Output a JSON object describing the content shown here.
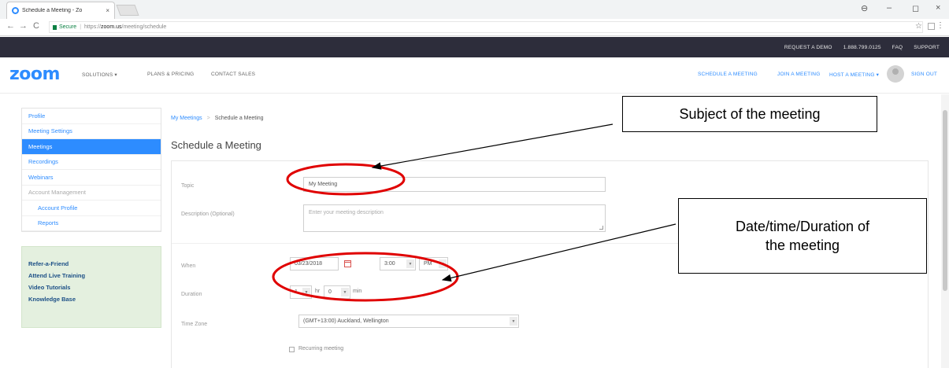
{
  "browser": {
    "tab_title": "Schedule a Meeting - Zo",
    "tab_close": "×",
    "controls": {
      "minimize": "–",
      "restore": "◻",
      "close": "×",
      "account": "⊖"
    },
    "secure_label": "Secure",
    "url_protocol": "https://",
    "url_host": "zoom.us",
    "url_path": "/meeting/schedule"
  },
  "topbar": {
    "links": [
      "REQUEST A DEMO",
      "1.888.799.0125",
      "FAQ",
      "SUPPORT"
    ]
  },
  "nav": {
    "logo": "zoom",
    "left_links": [
      "SOLUTIONS ▾",
      "PLANS & PRICING",
      "CONTACT SALES"
    ],
    "right_links": [
      "SCHEDULE A MEETING",
      "JOIN A MEETING",
      "HOST A MEETING ▾"
    ],
    "sign_out": "SIGN OUT"
  },
  "sidebar": {
    "items": [
      {
        "label": "Profile"
      },
      {
        "label": "Meeting Settings"
      },
      {
        "label": "Meetings"
      },
      {
        "label": "Recordings"
      },
      {
        "label": "Webinars"
      },
      {
        "label": "Account Management"
      },
      {
        "label": "Account Profile"
      },
      {
        "label": "Reports"
      }
    ],
    "help_links": [
      "Refer-a-Friend",
      "Attend Live Training",
      "Video Tutorials",
      "Knowledge Base"
    ]
  },
  "main": {
    "breadcrumb": {
      "link": "My Meetings",
      "separator": ">",
      "current": "Schedule a Meeting"
    },
    "title": "Schedule a Meeting",
    "form": {
      "topic_label": "Topic",
      "topic_value": "My Meeting",
      "description_label": "Description (Optional)",
      "description_placeholder": "Enter your meeting description",
      "when_label": "When",
      "date_value": "03/23/2018",
      "time_value": "3:00",
      "ampm_value": "PM",
      "duration_label": "Duration",
      "duration_hours": "1",
      "hr_label": "hr",
      "duration_minutes": "0",
      "min_label": "min",
      "timezone_label": "Time Zone",
      "timezone_value": "(GMT+13:00) Auckland, Wellington",
      "recurring_label": "Recurring meeting"
    }
  },
  "annotations": {
    "subject_callout": "Subject of the meeting",
    "datetime_callout_line1": "Date/time/Duration of",
    "datetime_callout_line2": "the meeting",
    "highlight_color": "#e00000"
  },
  "colors": {
    "brand_blue": "#2d8cff",
    "topbar_bg": "#2d2d3b",
    "help_bg": "#e4f0df"
  }
}
